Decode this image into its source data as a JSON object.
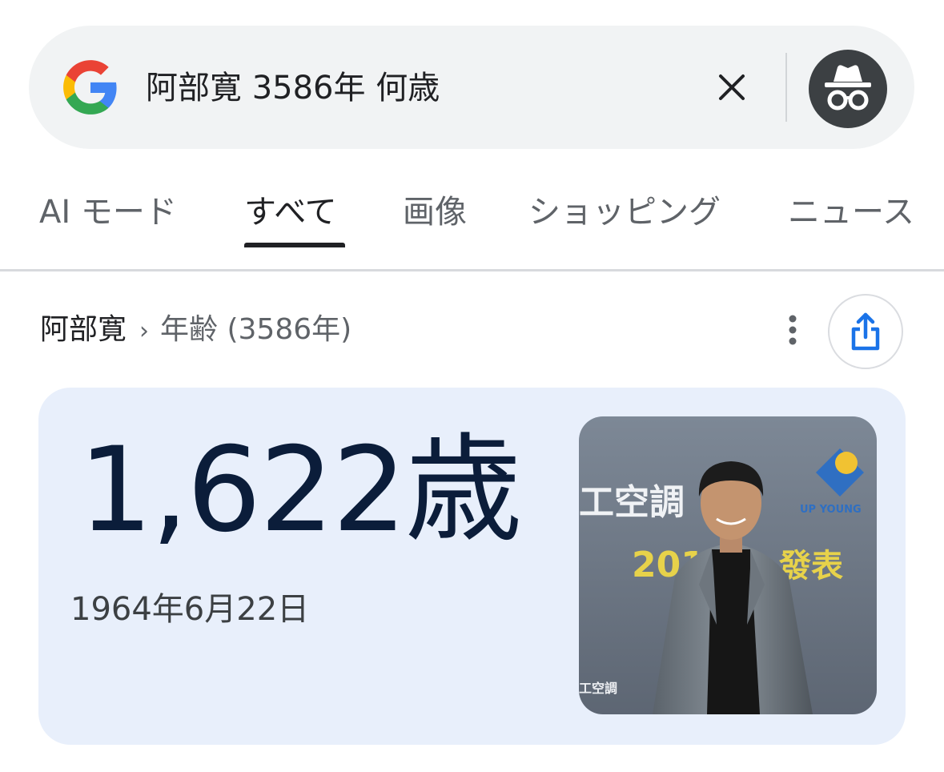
{
  "search": {
    "query": "阿部寛 3586年 何歳",
    "logo_icon": "google-g-icon",
    "clear_icon": "close-icon",
    "profile_icon": "incognito-icon"
  },
  "tabs": [
    {
      "label": "AI モード",
      "active": false
    },
    {
      "label": "すべて",
      "active": true
    },
    {
      "label": "画像",
      "active": false
    },
    {
      "label": "ショッピング",
      "active": false
    },
    {
      "label": "ニュース",
      "active": false
    }
  ],
  "result": {
    "breadcrumb_main": "阿部寛",
    "breadcrumb_sep": "›",
    "breadcrumb_sub": "年齢 (3586年)",
    "age": "1,622歳",
    "birth_date": "1964年6月22日",
    "photo": {
      "sign_left": "工空調",
      "sign_year": "201",
      "sign_right": "發表",
      "sign_logo": "UP YOUNG",
      "sign_bottom": "工空調"
    }
  },
  "colors": {
    "accent": "#1a73e8",
    "card_bg": "#e8effb",
    "age_text": "#0b1d3a"
  }
}
